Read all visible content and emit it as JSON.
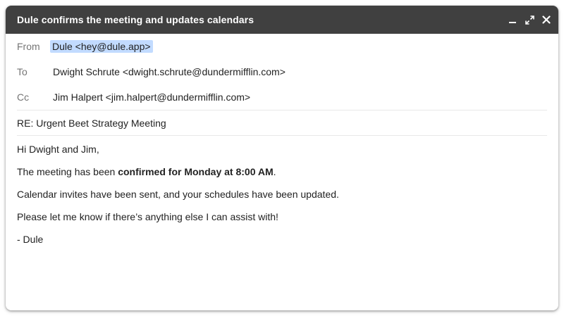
{
  "window": {
    "title": "Dule confirms the meeting and updates calendars",
    "controls": [
      "minimize-icon",
      "expand-icon",
      "close-icon"
    ]
  },
  "headers": {
    "from_label": "From",
    "from_value": "Dule <hey@dule.app>",
    "to_label": "To",
    "to_value": "Dwight Schrute <dwight.schrute@dundermifflin.com>",
    "cc_label": "Cc",
    "cc_value": "Jim Halpert <jim.halpert@dundermifflin.com>"
  },
  "subject": "RE: Urgent Beet Strategy Meeting",
  "body": {
    "greeting": "Hi Dwight and Jim,",
    "line1_prefix": "The meeting has been ",
    "line1_bold": "confirmed for Monday at 8:00 AM",
    "line1_suffix": ".",
    "line2": "Calendar invites have been sent, and your schedules have been updated.",
    "line3": "Please let me know if there’s anything else I can assist with!",
    "signature": "- Dule"
  },
  "colors": {
    "titlebar": "#404040",
    "from_highlight": "#c2dbff",
    "label_gray": "#757575"
  }
}
